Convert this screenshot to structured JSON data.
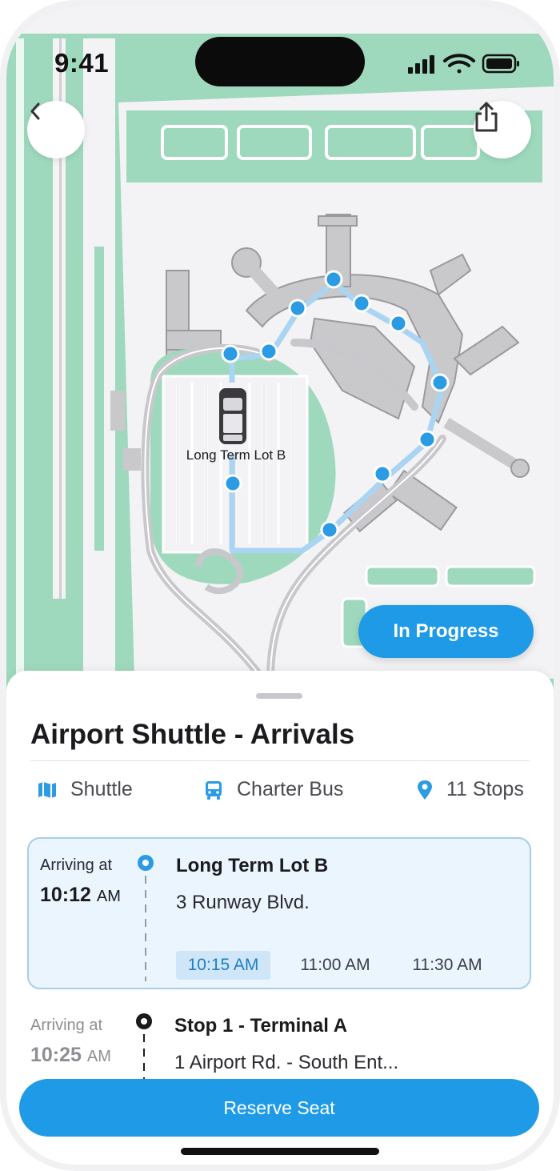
{
  "status_bar": {
    "time": "9:41"
  },
  "map": {
    "lot_label": "Long Term Lot B",
    "status_button": "In Progress",
    "colors": {
      "grass": "#9fd9bd",
      "land": "#f3f3f5",
      "road": "#c8c8cc",
      "route": "#a9d4f2",
      "stop": "#2b9be4",
      "building": "#c9c9cc"
    }
  },
  "sheet": {
    "title": "Airport Shuttle - Arrivals",
    "meta": [
      {
        "icon": "map-icon",
        "label": "Shuttle"
      },
      {
        "icon": "bus-icon",
        "label": "Charter Bus"
      },
      {
        "icon": "location-pin-icon",
        "label": "11 Stops"
      }
    ],
    "stops": [
      {
        "arriving_label": "Arriving at",
        "time": "10:12",
        "ampm": "AM",
        "name": "Long Term Lot B",
        "address": "3 Runway Blvd.",
        "departures": [
          "10:15 AM",
          "11:00 AM",
          "11:30 AM"
        ],
        "selected_departure": "10:15 AM"
      },
      {
        "arriving_label": "Arriving at",
        "time": "10:25",
        "ampm": "AM",
        "name": "Stop 1 - Terminal A",
        "address": "1 Airport Rd. - South Ent..."
      }
    ],
    "reserve_button": "Reserve Seat"
  },
  "accent_color": "#1e9ae6"
}
